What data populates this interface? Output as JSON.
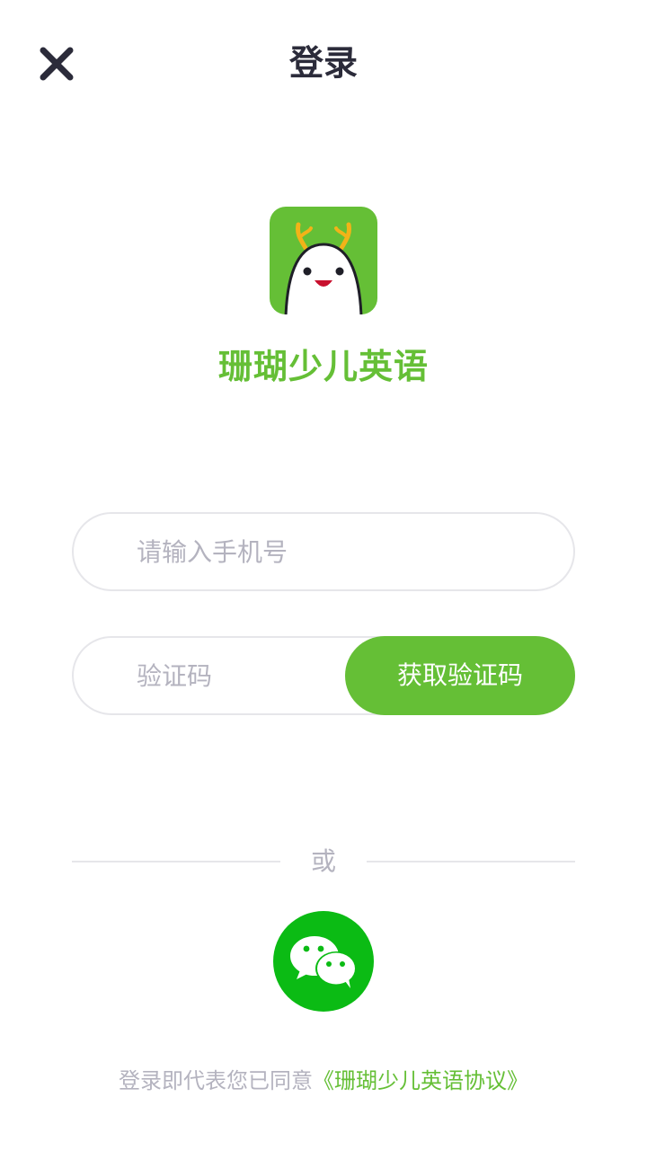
{
  "header": {
    "title": "登录",
    "close_icon": "close-icon"
  },
  "brand": {
    "logo_icon": "coral-mascot-logo",
    "name": "珊瑚少儿英语",
    "color": "#65bf36"
  },
  "form": {
    "phone_placeholder": "请输入手机号",
    "phone_value": "",
    "code_placeholder": "验证码",
    "code_value": "",
    "get_code_label": "获取验证码"
  },
  "divider": {
    "text": "或"
  },
  "social": {
    "wechat_icon": "wechat-icon",
    "wechat_color": "#0bbb14"
  },
  "agreement": {
    "prefix": "登录即代表您已同意",
    "link": "《珊瑚少儿英语协议》"
  }
}
